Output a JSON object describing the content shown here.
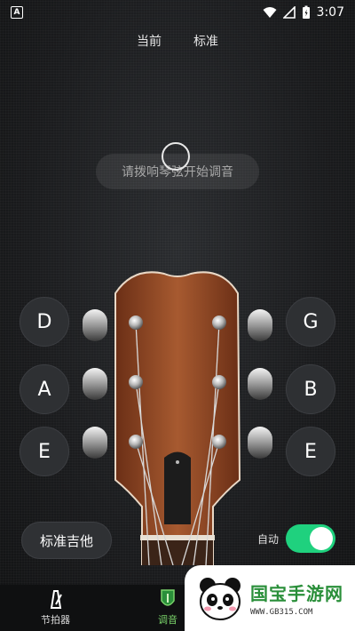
{
  "status_bar": {
    "notification_icon": "A",
    "time": "3:07",
    "icons": [
      "wifi-icon",
      "signal-icon",
      "battery-icon"
    ]
  },
  "top_tabs": [
    {
      "label": "当前"
    },
    {
      "label": "标准"
    }
  ],
  "prompt": "请拨响琴弦开始调音",
  "strings": {
    "left": [
      {
        "note": "D"
      },
      {
        "note": "A"
      },
      {
        "note": "E"
      }
    ],
    "right": [
      {
        "note": "G"
      },
      {
        "note": "B"
      },
      {
        "note": "E"
      }
    ]
  },
  "preset_button": "标准吉他",
  "auto": {
    "label": "自动",
    "on": true
  },
  "bottom_nav": [
    {
      "label": "节拍器",
      "icon": "metronome-icon"
    },
    {
      "label": "调音",
      "icon": "tuner-icon",
      "active": true
    }
  ],
  "watermark": {
    "title": "国宝手游网",
    "url": "WWW.GB315.COM"
  },
  "colors": {
    "accent": "#1fd17e",
    "background": "#151617",
    "wood": "#9a4a26"
  }
}
